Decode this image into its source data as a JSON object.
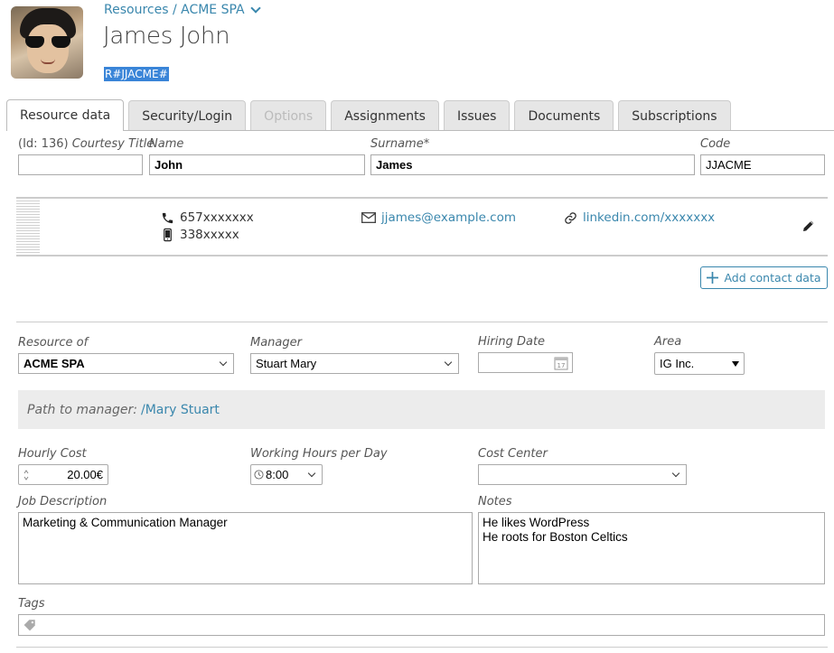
{
  "header": {
    "breadcrumb": "Resources / ACME SPA",
    "title": "James John",
    "code": "R#JJACME#"
  },
  "tabs": [
    {
      "label": "Resource data",
      "state": "active"
    },
    {
      "label": "Security/Login",
      "state": "normal"
    },
    {
      "label": "Options",
      "state": "disabled"
    },
    {
      "label": "Assignments",
      "state": "normal"
    },
    {
      "label": "Issues",
      "state": "normal"
    },
    {
      "label": "Documents",
      "state": "normal"
    },
    {
      "label": "Subscriptions",
      "state": "normal"
    }
  ],
  "identity": {
    "id_label": "(Id: 136)",
    "courtesy_label": "Courtesy Title",
    "courtesy_value": "",
    "name_label": "Name",
    "name_value": "John",
    "surname_label": "Surname*",
    "surname_value": "James",
    "code_label": "Code",
    "code_value": "JJACME"
  },
  "contacts": {
    "phone": "657xxxxxxx",
    "mobile": "338xxxxx",
    "email": "jjames@example.com",
    "website": "linkedin.com/xxxxxxx",
    "add_button": "Add contact data"
  },
  "org": {
    "resource_of_label": "Resource of",
    "resource_of_value": "ACME SPA",
    "manager_label": "Manager",
    "manager_value": "Stuart Mary",
    "hiring_label": "Hiring Date",
    "hiring_value": "",
    "calendar_day": "17",
    "area_label": "Area",
    "area_value": "IG Inc.",
    "path_label": "Path to manager:",
    "path_value": "/Mary Stuart"
  },
  "costs": {
    "hourly_label": "Hourly Cost",
    "hourly_value": "20.00€",
    "hours_label": "Working Hours per Day",
    "hours_value": "8:00",
    "cost_center_label": "Cost Center",
    "cost_center_value": ""
  },
  "texts": {
    "job_label": "Job Description",
    "job_value": "Marketing & Communication Manager",
    "notes_label": "Notes",
    "notes_value": "He likes WordPress\nHe roots for Boston Celtics",
    "tags_label": "Tags"
  },
  "colors": {
    "link": "#3a87ad",
    "selection": "#3a85d8"
  }
}
